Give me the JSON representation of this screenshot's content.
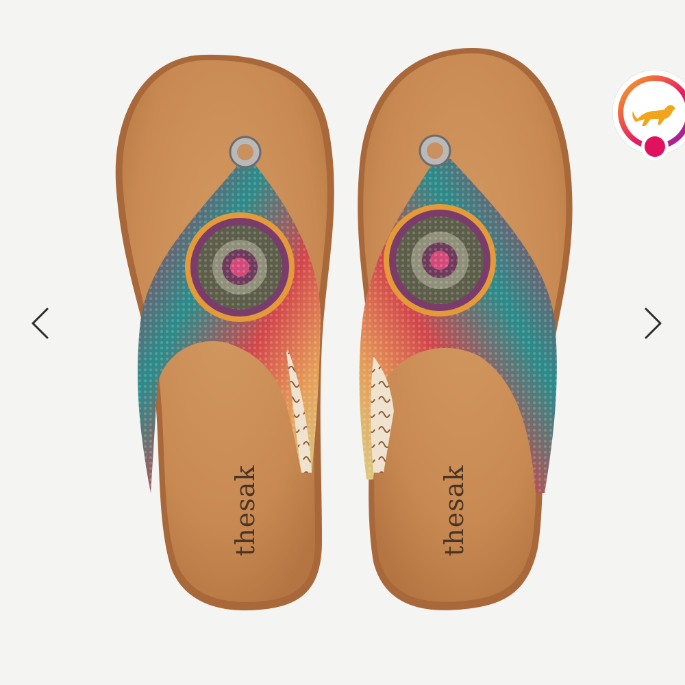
{
  "carousel": {
    "prev_icon": "chevron-left-icon",
    "next_icon": "chevron-right-icon"
  },
  "product": {
    "brand_imprint": "thesak"
  },
  "badge": {
    "icon": "running-dog-icon",
    "ring_gradient": [
      "#f5a623",
      "#e91e63",
      "#8e24aa"
    ],
    "dot_color": "#e0115f",
    "dog_color": "#f2a51a"
  },
  "colors": {
    "background": "#f4f4f3",
    "footbed": "#c98b52",
    "footbed_edge": "#a8683a"
  }
}
